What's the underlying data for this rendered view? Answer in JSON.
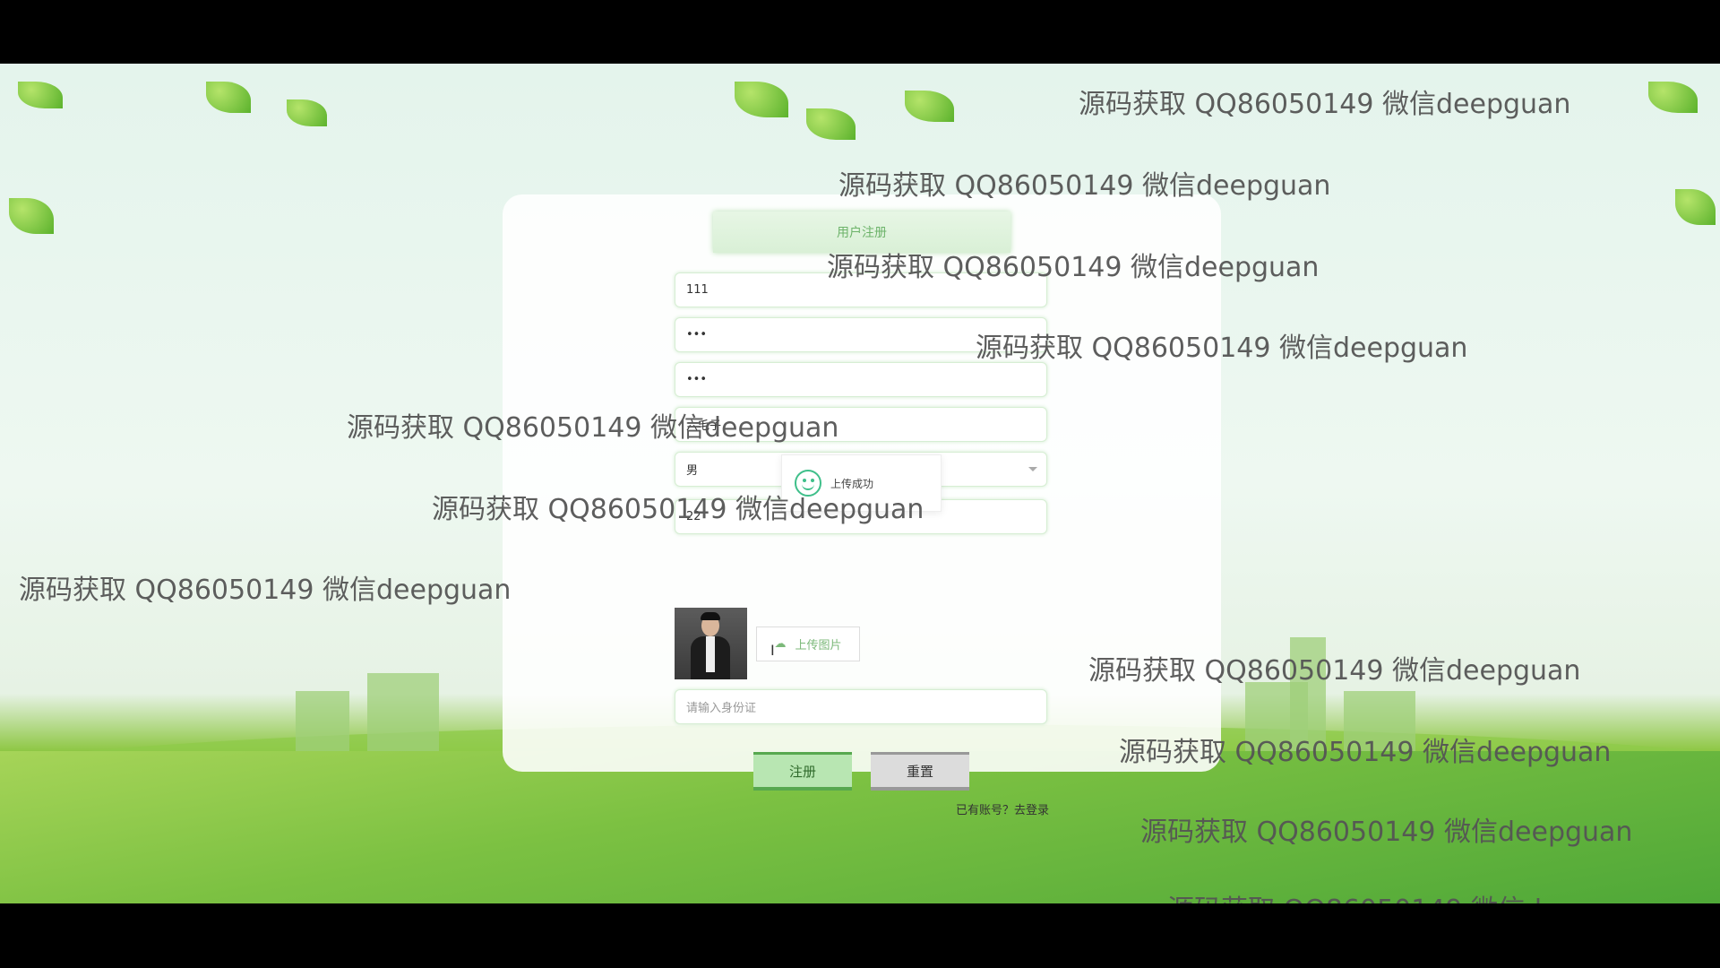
{
  "form": {
    "title": "用户注册",
    "username": "111",
    "password": "•••",
    "confirm_password": "•••",
    "name": "六毛子",
    "gender": "男",
    "age": "22",
    "upload_button": "上传图片",
    "id_placeholder": "请输入身份证",
    "register_button": "注册",
    "reset_button": "重置",
    "login_link": "已有账号？去登录"
  },
  "toast": {
    "message": "上传成功"
  },
  "watermark": "源码获取 QQ86050149 微信deepguan",
  "colors": {
    "accent": "#57a84f",
    "toast_icon": "#3fbf8a"
  }
}
